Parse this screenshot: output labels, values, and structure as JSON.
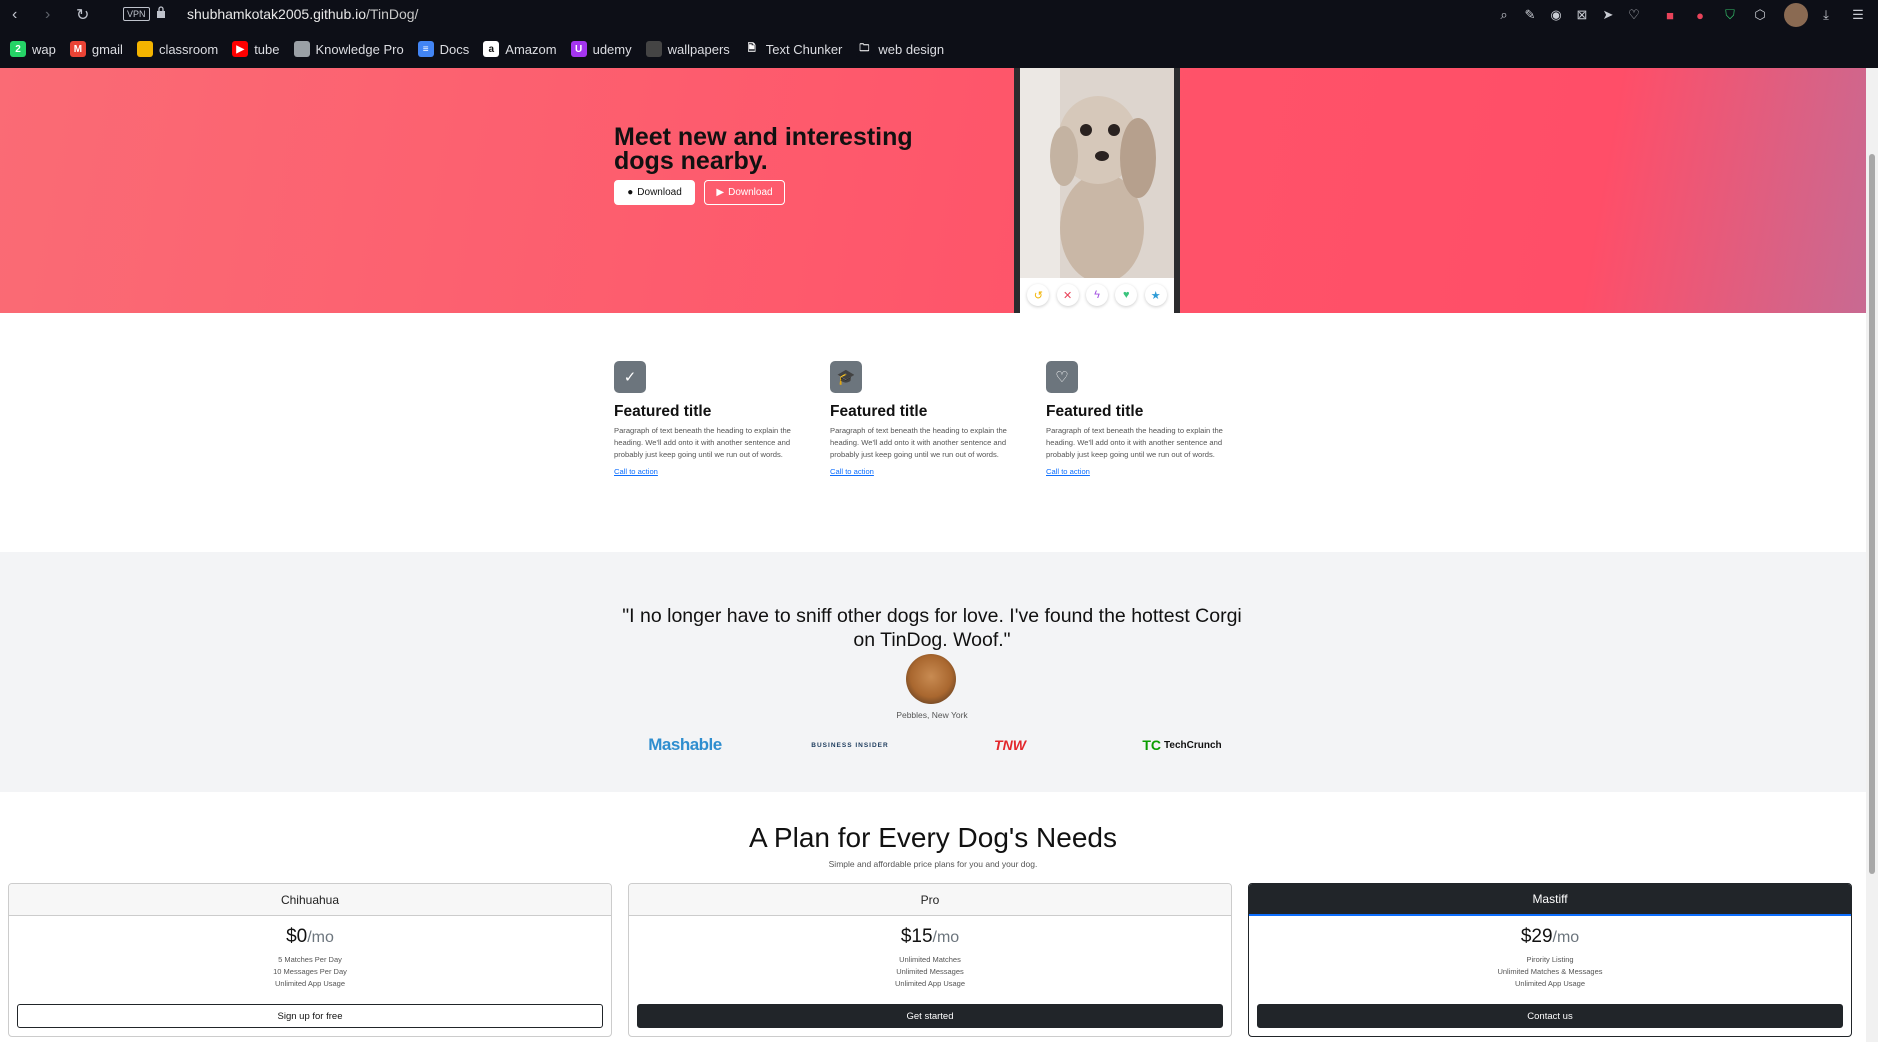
{
  "browser": {
    "url_host": "shubhamkotak2005.github.io",
    "url_path": "/TinDog/",
    "vpn_label": "VPN",
    "bookmarks": [
      {
        "label": "wap",
        "icon": "whatsapp-icon",
        "color": "#25d366",
        "glyph": "2"
      },
      {
        "label": "gmail",
        "icon": "gmail-icon",
        "color": "#ea4335",
        "glyph": "M"
      },
      {
        "label": "classroom",
        "icon": "classroom-icon",
        "color": "#f4b400",
        "glyph": ""
      },
      {
        "label": "tube",
        "icon": "youtube-icon",
        "color": "#ff0000",
        "glyph": "▶"
      },
      {
        "label": "Knowledge Pro",
        "icon": "knowledge-pro-icon",
        "color": "#9aa0a6",
        "glyph": ""
      },
      {
        "label": "Docs",
        "icon": "docs-icon",
        "color": "#4285f4",
        "glyph": "≡"
      },
      {
        "label": "Amazom",
        "icon": "amazon-icon",
        "color": "#ffffff",
        "glyph": "a"
      },
      {
        "label": "udemy",
        "icon": "udemy-icon",
        "color": "#a435f0",
        "glyph": "U"
      },
      {
        "label": "wallpapers",
        "icon": "wallpapers-icon",
        "color": "#444",
        "glyph": ""
      },
      {
        "label": "Text Chunker",
        "icon": "document-icon",
        "color": "#0d0f17",
        "glyph": "🗎"
      },
      {
        "label": "web design",
        "icon": "folder-icon",
        "color": "#0d0f17",
        "glyph": "🗀"
      }
    ]
  },
  "hero": {
    "title": "Meet new and interesting dogs nearby.",
    "download_apple": "Download",
    "download_play": "Download"
  },
  "features": [
    {
      "title": "Featured title",
      "text": "Paragraph of text beneath the heading to explain the heading. We'll add onto it with another sentence and probably just keep going until we run out of words.",
      "link": "Call to action",
      "icon": "check-circle-icon",
      "glyph": "✓"
    },
    {
      "title": "Featured title",
      "text": "Paragraph of text beneath the heading to explain the heading. We'll add onto it with another sentence and probably just keep going until we run out of words.",
      "link": "Call to action",
      "icon": "graduation-cap-icon",
      "glyph": "🎓"
    },
    {
      "title": "Featured title",
      "text": "Paragraph of text beneath the heading to explain the heading. We'll add onto it with another sentence and probably just keep going until we run out of words.",
      "link": "Call to action",
      "icon": "heart-arrow-icon",
      "glyph": "♡"
    }
  ],
  "testimonial": {
    "quote": "\"I no longer have to sniff other dogs for love. I've found the hottest Corgi on TinDog. Woof.\"",
    "caption": "Pebbles, New York",
    "press": [
      "Mashable",
      "BUSINESS INSIDER",
      "TNW",
      "TechCrunch"
    ]
  },
  "pricing": {
    "title": "A Plan for Every Dog's Needs",
    "subtitle": "Simple and affordable price plans for you and your dog.",
    "plans": [
      {
        "name": "Chihuahua",
        "price": "$0",
        "per": "/mo",
        "features": [
          "5 Matches Per Day",
          "10 Messages Per Day",
          "Unlimited App Usage"
        ],
        "button": "Sign up for free"
      },
      {
        "name": "Pro",
        "price": "$15",
        "per": "/mo",
        "features": [
          "Unlimited Matches",
          "Unlimited Messages",
          "Unlimited App Usage"
        ],
        "button": "Get started"
      },
      {
        "name": "Mastiff",
        "price": "$29",
        "per": "/mo",
        "features": [
          "Pirority Listing",
          "Unlimited Matches & Messages",
          "Unlimited App Usage"
        ],
        "button": "Contact us"
      }
    ]
  }
}
